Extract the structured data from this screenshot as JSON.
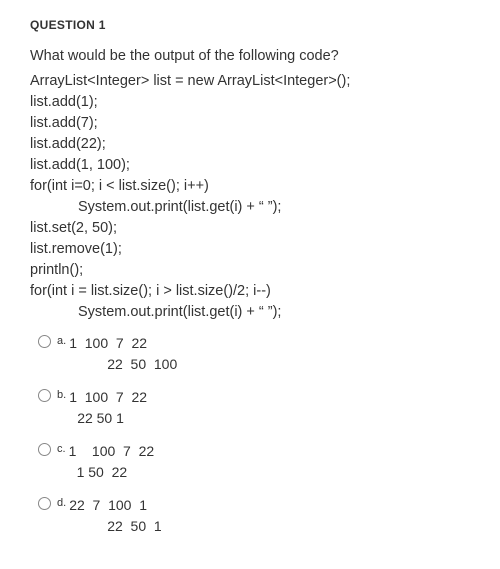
{
  "header": "QUESTION 1",
  "prompt": "What would be the output of the following code?",
  "code": {
    "l1": "ArrayList<Integer> list = new ArrayList<Integer>();",
    "l2": "list.add(1);",
    "l3": "list.add(7);",
    "l4": "list.add(22);",
    "l5": "list.add(1, 100);",
    "l6": "for(int i=0; i < list.size(); i++)",
    "l7": "System.out.print(list.get(i) + “  ”);",
    "l8": "list.set(2, 50);",
    "l9": "list.remove(1);",
    "l10": "println();",
    "l11": "for(int i = list.size(); i > list.size()/2; i--)",
    "l12": "System.out.print(list.get(i) + “  ”);"
  },
  "options": {
    "a": {
      "letter": "a.",
      "line1": "1  100  7  22",
      "line2": "22  50  100"
    },
    "b": {
      "letter": "b.",
      "line1": "1  100  7  22",
      "line2": "22 50 1"
    },
    "c": {
      "letter": "c.",
      "line1": "1    100  7  22",
      "line2": "1 50  22"
    },
    "d": {
      "letter": "d.",
      "line1": "22  7  100  1",
      "line2": "22  50  1"
    }
  }
}
